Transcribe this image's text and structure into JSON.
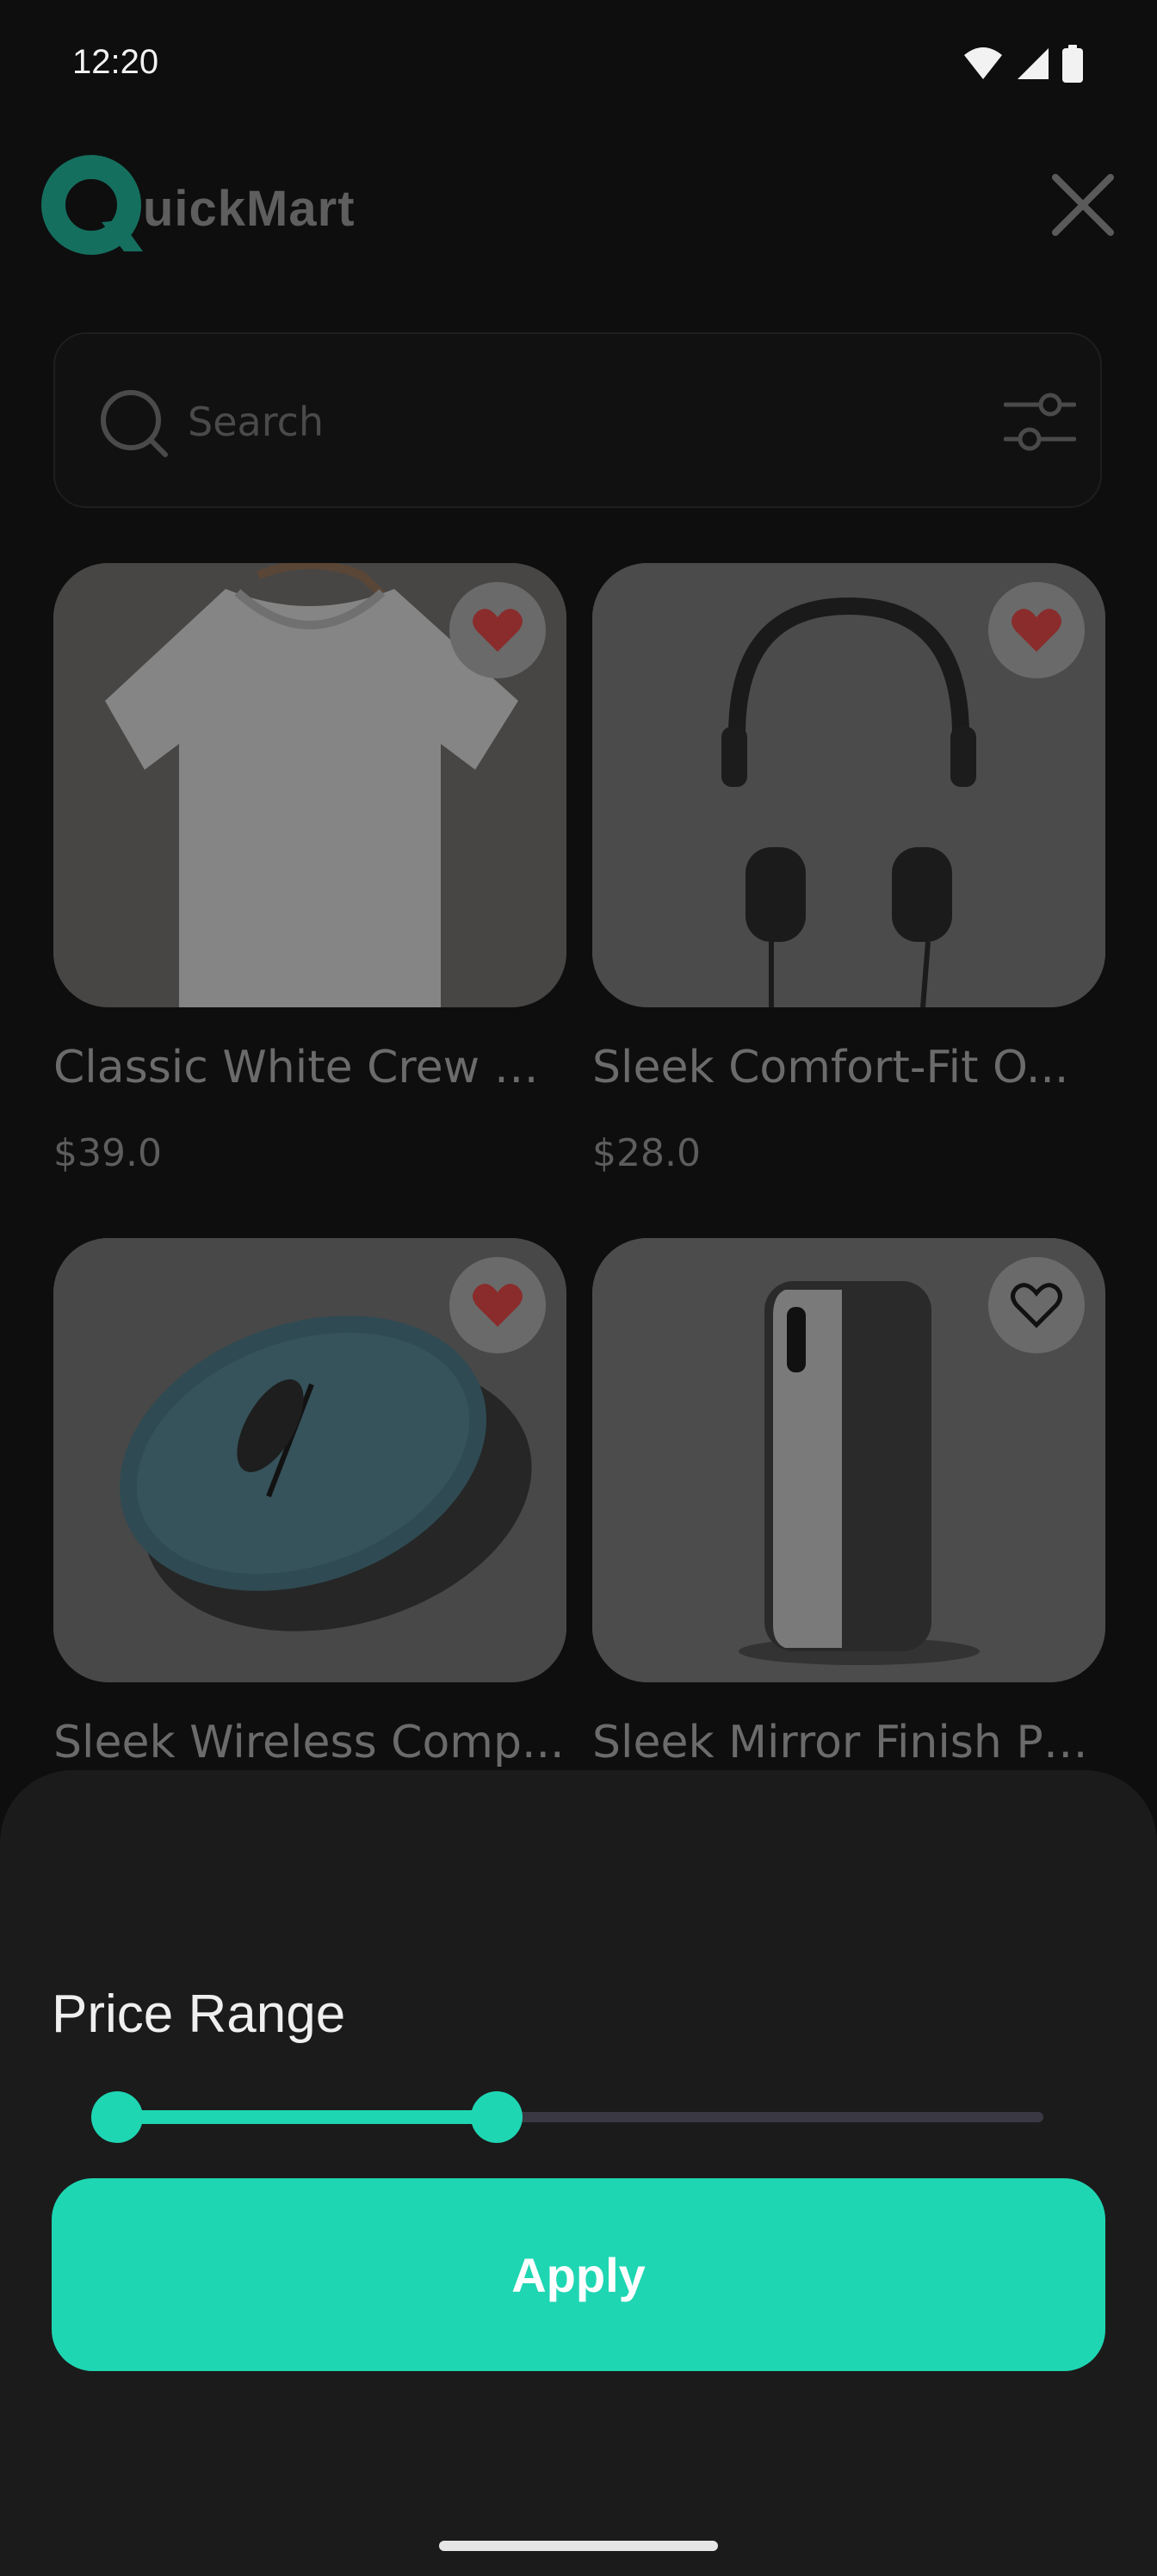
{
  "status_bar": {
    "time": "12:20"
  },
  "header": {
    "brand_letter": "Q",
    "brand_rest": "uickMart",
    "brand_color": "#156f5f"
  },
  "search": {
    "placeholder": "Search"
  },
  "products": [
    {
      "name": "Classic White Crew N...",
      "price": "$39.0",
      "favorited": true,
      "image": "white-tshirt"
    },
    {
      "name": "Sleek Comfort-Fit O...",
      "price": "$28.0",
      "favorited": true,
      "image": "headphones"
    },
    {
      "name": "Sleek Wireless Comp...",
      "favorited": true,
      "image": "wireless-mouse"
    },
    {
      "name": "Sleek Mirror Finish Ph...",
      "favorited": false,
      "image": "smartphone"
    }
  ],
  "filter_sheet": {
    "title": "Price Range",
    "range_low_fraction": 0.0,
    "range_high_fraction": 0.41,
    "apply_label": "Apply"
  },
  "colors": {
    "accent": "#1fd6b3",
    "heart": "#8a2c2c",
    "sheet_bg": "#1b1b1b"
  }
}
